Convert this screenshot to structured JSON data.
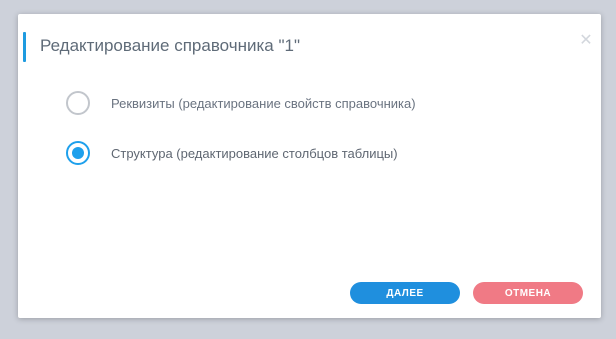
{
  "dialog": {
    "title": "Редактирование справочника \"1\"",
    "close_icon": "close-icon",
    "options": [
      {
        "label": "Реквизиты (редактирование свойств справочника)",
        "checked": false
      },
      {
        "label": "Структура (редактирование столбцов таблицы)",
        "checked": true
      }
    ],
    "buttons": {
      "next_label": "ДАЛЕЕ",
      "cancel_label": "ОТМЕНА"
    }
  },
  "colors": {
    "accent": "#1ea0ec",
    "primary_button": "#1f8fde",
    "cancel_button": "#f07a85"
  }
}
